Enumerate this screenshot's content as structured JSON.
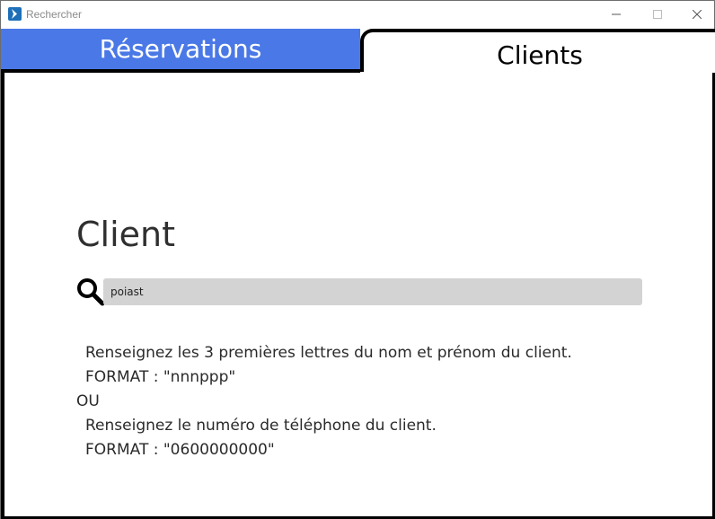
{
  "window": {
    "title": "Rechercher",
    "controls": {
      "minimize": "—",
      "maximize": "☐",
      "close": "✕"
    }
  },
  "tabs": [
    {
      "label": "Réservations",
      "active": false,
      "color": "#4a78e6"
    },
    {
      "label": "Clients",
      "active": true
    }
  ],
  "main": {
    "heading": "Client",
    "search": {
      "value": "poiast",
      "placeholder": ""
    },
    "instructions": {
      "line1": "Renseignez les 3 premières lettres du nom et prénom du client.",
      "format1": "FORMAT : \"nnnppp\"",
      "or": "OU",
      "line2": "Renseignez le numéro de téléphone du client.",
      "format2": "FORMAT : \"0600000000\""
    }
  },
  "icons": {
    "app": "app-icon",
    "search": "magnifier-icon"
  }
}
